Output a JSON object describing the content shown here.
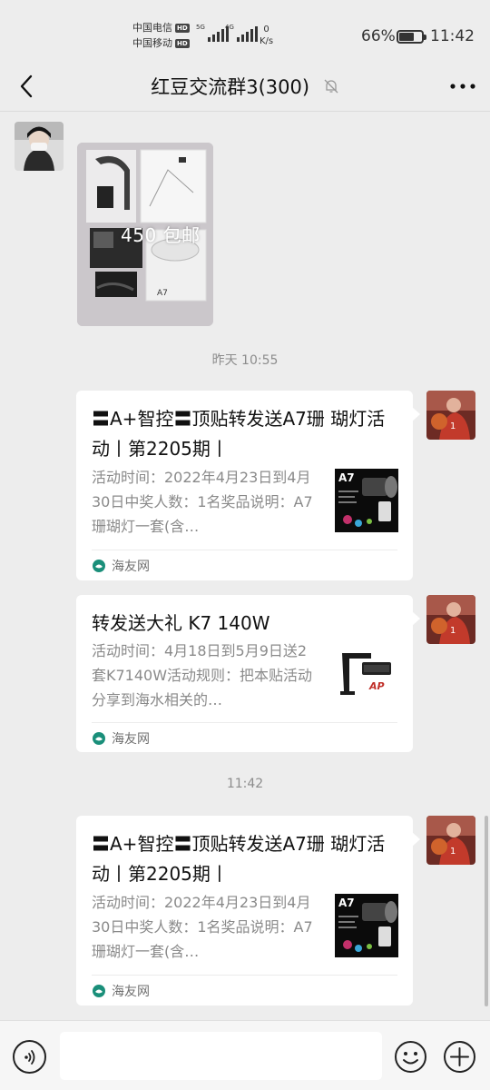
{
  "status_bar": {
    "carrier_1": "中国电信",
    "carrier_2": "中国移动",
    "hd_badge": "HD",
    "net_1": "5G",
    "net_2": "4G",
    "speed_value": "0",
    "speed_unit": "K/s",
    "battery_percent": "66%",
    "battery_level": 0.66,
    "time": "11:42"
  },
  "nav": {
    "title": "红豆交流群3(300)",
    "back_icon": "chevron-left-icon",
    "mute_icon": "bell-off-icon",
    "more_icon": "more-dots-icon"
  },
  "messages": {
    "photo_caption": "450 包邮",
    "time_1": "昨天 10:55",
    "card_1": {
      "title": "〓A+智控〓顶贴转发送A7珊 瑚灯活动丨第2205期丨",
      "desc": "活动时间：2022年4月23日到4月30日中奖人数：1名奖品说明：A7珊瑚灯一套(含…",
      "thumb_label": "A7",
      "source": "海友网"
    },
    "card_2": {
      "title": "转发送大礼 K7 140W",
      "desc": "活动时间：4月18日到5月9日送2套K7140W活动规则：把本贴活动分享到海水相关的…",
      "thumb_label": "AP",
      "source": "海友网"
    },
    "time_2": "11:42",
    "card_3": {
      "title": "〓A+智控〓顶贴转发送A7珊 瑚灯活动丨第2205期丨",
      "desc": "活动时间：2022年4月23日到4月30日中奖人数：1名奖品说明：A7珊瑚灯一套(含…",
      "thumb_label": "A7",
      "source": "海友网"
    }
  },
  "input_bar": {
    "placeholder": "",
    "voice_icon": "voice-icon",
    "emoji_icon": "emoji-icon",
    "plus_icon": "plus-icon"
  },
  "colors": {
    "background": "#ededed",
    "bubble": "#ffffff",
    "source_green": "#1a8f7a"
  }
}
